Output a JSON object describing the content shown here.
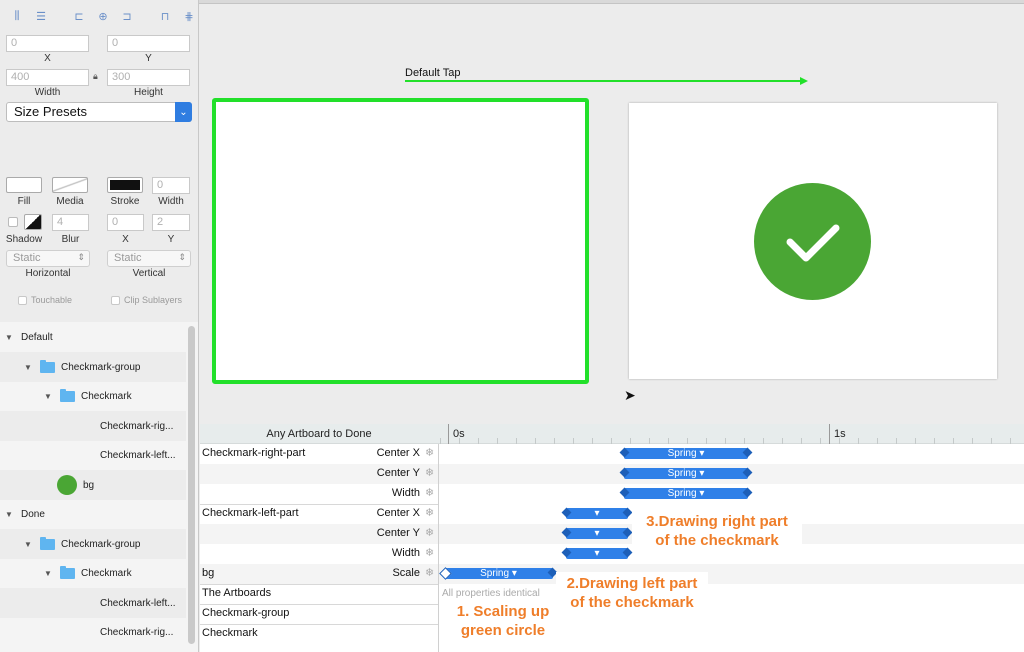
{
  "inspector": {
    "x": {
      "value": "0",
      "label": "X"
    },
    "y": {
      "value": "0",
      "label": "Y"
    },
    "width": {
      "value": "400",
      "label": "Width"
    },
    "height": {
      "value": "300",
      "label": "Height"
    },
    "size_presets": "Size Presets",
    "fill_label": "Fill",
    "media_label": "Media",
    "stroke_label": "Stroke",
    "stroke_width": {
      "value": "0",
      "label": "Width"
    },
    "shadow_label": "Shadow",
    "blur": {
      "value": "4",
      "label": "Blur"
    },
    "shadow_x": {
      "value": "0",
      "label": "X"
    },
    "shadow_y": {
      "value": "2",
      "label": "Y"
    },
    "horizontal": {
      "value": "Static",
      "label": "Horizontal"
    },
    "vertical": {
      "value": "Static",
      "label": "Vertical"
    },
    "touchable": "Touchable",
    "clip_sublayers": "Clip Sublayers"
  },
  "layers": [
    {
      "label": "Default"
    },
    {
      "label": "Checkmark-group"
    },
    {
      "label": "Checkmark"
    },
    {
      "label": "Checkmark-rig..."
    },
    {
      "label": "Checkmark-left..."
    },
    {
      "label": "bg"
    },
    {
      "label": "Done"
    },
    {
      "label": "Checkmark-group"
    },
    {
      "label": "Checkmark"
    },
    {
      "label": "Checkmark-left..."
    },
    {
      "label": "Checkmark-rig..."
    }
  ],
  "canvas": {
    "tap_label": "Default Tap"
  },
  "timeline": {
    "transition": "Any Artboard to Done",
    "tick_0": "0s",
    "tick_1": "1s",
    "rows": [
      {
        "name": "Checkmark-right-part",
        "prop": "Center X"
      },
      {
        "name": "",
        "prop": "Center Y"
      },
      {
        "name": "",
        "prop": "Width"
      },
      {
        "name": "Checkmark-left-part",
        "prop": "Center X"
      },
      {
        "name": "",
        "prop": "Center Y"
      },
      {
        "name": "",
        "prop": "Width"
      },
      {
        "name": "bg",
        "prop": "Scale"
      },
      {
        "name": "The Artboards",
        "prop": ""
      },
      {
        "name": "Checkmark-group",
        "prop": ""
      },
      {
        "name": "Checkmark",
        "prop": ""
      }
    ],
    "bar_spring": "Spring ▾",
    "bar_empty": "▾",
    "identical_note": "All properties identical"
  },
  "annotations": {
    "note1": "1. Scaling up\ngreen circle",
    "note2": "2.Drawing left part\nof the checkmark",
    "note3": "3.Drawing right part\nof the checkmark"
  },
  "colors": {
    "accent_green": "#22e02a",
    "circle_green": "#4aa634",
    "bar_blue": "#2f80e8",
    "note_orange": "#ef7e2a"
  }
}
